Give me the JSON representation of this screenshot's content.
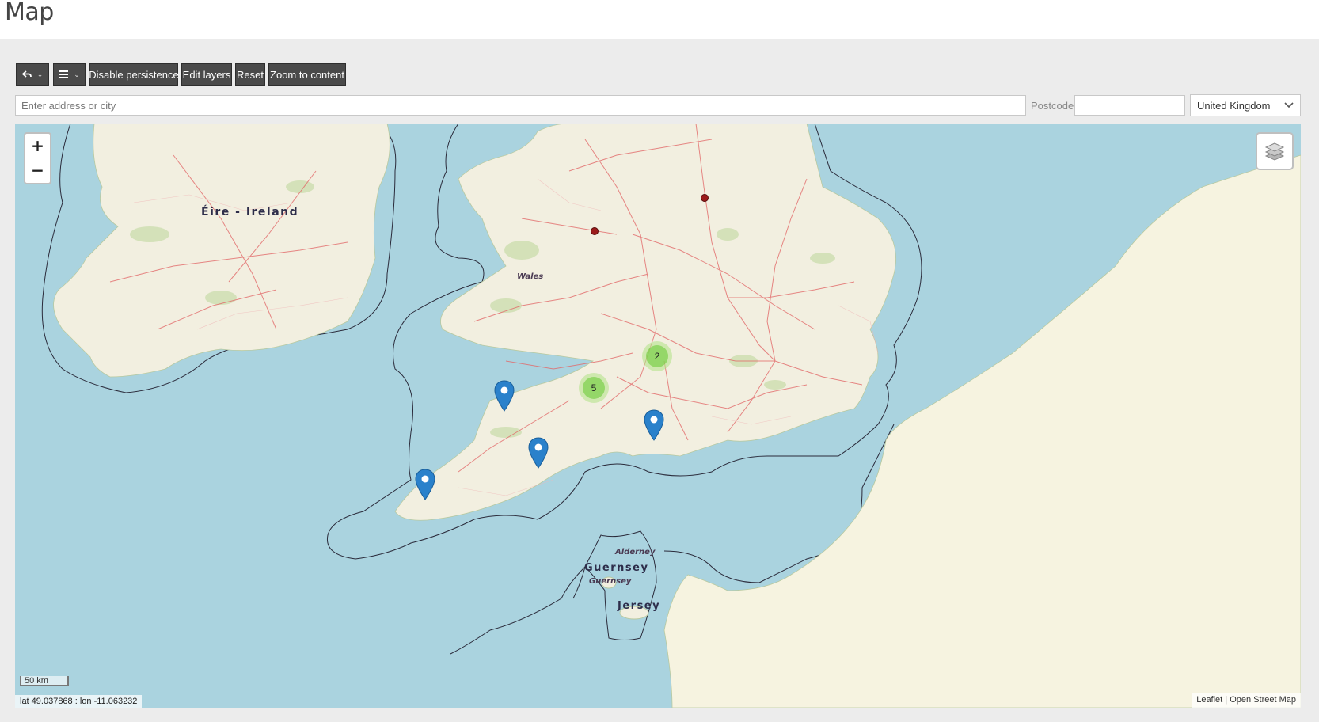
{
  "page": {
    "title": "Map"
  },
  "toolbar": {
    "back_icon": "undo-arrow-icon",
    "menu_icon": "hamburger-menu-icon",
    "disable_persistence": "Disable persistence",
    "edit_layers": "Edit layers",
    "reset": "Reset",
    "zoom_to_content": "Zoom to content"
  },
  "search": {
    "address_placeholder": "Enter address or city",
    "address_value": "",
    "postcode_label": "Postcode",
    "postcode_value": "",
    "country_selected": "United Kingdom"
  },
  "map": {
    "zoom_in": "+",
    "zoom_out": "−",
    "layers_icon": "layers-icon",
    "scale_label": "50 km",
    "coordinates": "lat 49.037868 : lon -11.063232",
    "attribution_leaflet": "Leaflet",
    "attribution_separator": "|",
    "attribution_osm": "Open Street Map",
    "labels": {
      "ireland": "Éire - Ireland",
      "wales": "Wales",
      "alderney": "Alderney",
      "guernsey_region": "Guernsey",
      "guernsey_island": "Guernsey",
      "jersey": "Jersey"
    },
    "clusters": [
      {
        "count": "2"
      },
      {
        "count": "5"
      }
    ],
    "colors": {
      "sea": "#aad3df",
      "land": "#f2efe0",
      "road": "#e26a6a",
      "marker": "#2a81cb",
      "cluster": "#6ecc39",
      "dot": "#9b1b1b"
    }
  }
}
